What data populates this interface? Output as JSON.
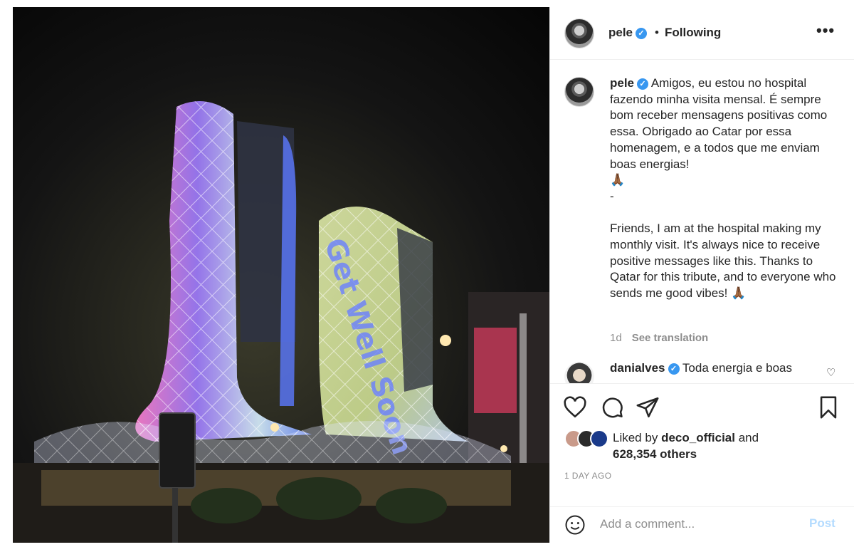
{
  "post": {
    "image_overlay_text": "Get Well Soon"
  },
  "header": {
    "username": "pele",
    "verified_badge": "✓",
    "separator": "•",
    "follow_status": "Following",
    "more_label": "•••"
  },
  "caption": {
    "username": "pele",
    "text": "Amigos, eu estou no hospital fazendo minha visita mensal. É sempre bom receber mensagens positivas como essa. Obrigado ao Catar por essa homenagem, e a todos que me enviam boas energias!\n🙏🏾\n-\n\nFriends, I am at the hospital making my monthly visit. It's always nice to receive positive messages like this. Thanks to Qatar for this tribute, and to everyone who sends me good vibes! 🙏🏾",
    "time": "1d",
    "see_translation": "See translation"
  },
  "comment": {
    "username": "danialves",
    "text": "Toda energia e boas"
  },
  "actions": {
    "icons": [
      "heart-icon",
      "comment-icon",
      "share-icon",
      "bookmark-icon"
    ]
  },
  "likes": {
    "prefix": "Liked by",
    "liker": "deco_official",
    "suffix": "and",
    "others": "628,354 others"
  },
  "timestamp": "1 DAY AGO",
  "add_comment": {
    "placeholder": "Add a comment...",
    "post_label": "Post"
  },
  "colors": {
    "verified": "#3897f0",
    "post_disabled": "#b3dbff",
    "muted": "#8e8e8e"
  }
}
